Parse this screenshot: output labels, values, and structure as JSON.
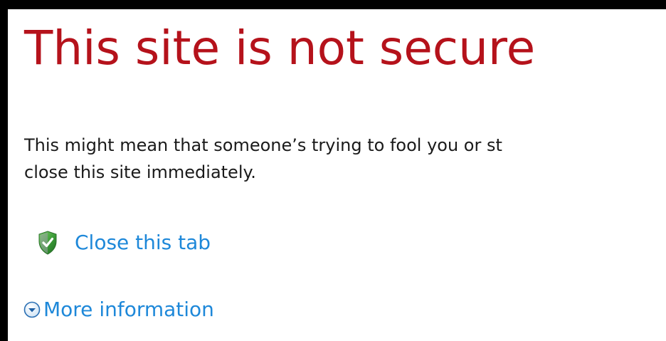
{
  "error_page": {
    "title": "This site is not secure",
    "description_line1": "This might mean that someone’s trying to fool you or st",
    "description_line2": "close this site immediately.",
    "close_tab_label": "Close this tab",
    "close_tab_icon": "shield-check-icon",
    "more_info_label": "More information",
    "more_info_icon": "expand-circle-icon"
  },
  "colors": {
    "title": "#b5121b",
    "link": "#1e88d9",
    "text": "#1a1a1a",
    "border": "#000000"
  }
}
